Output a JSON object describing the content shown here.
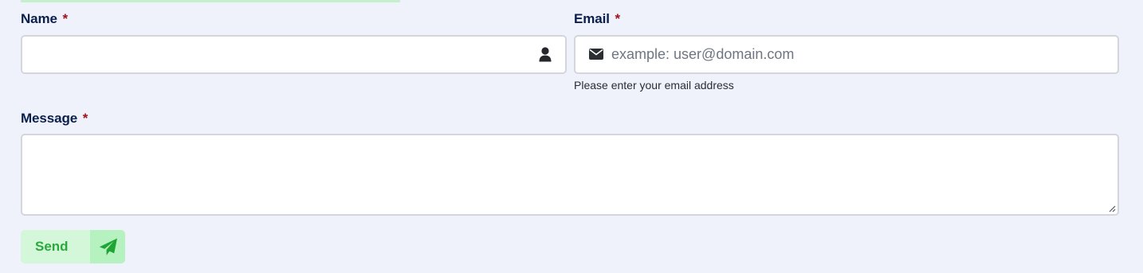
{
  "form": {
    "name": {
      "label": "Name",
      "required_mark": "*",
      "value": "",
      "icon": "user-icon"
    },
    "email": {
      "label": "Email",
      "required_mark": "*",
      "value": "",
      "placeholder": "example: user@domain.com",
      "icon": "envelope-icon",
      "helper": "Please enter your email address"
    },
    "message": {
      "label": "Message",
      "required_mark": "*",
      "value": ""
    },
    "send_button": {
      "label": "Send",
      "icon": "paper-plane-icon"
    }
  },
  "colors": {
    "background": "#eff2fb",
    "label": "#0a1f4c",
    "required": "#a0121c",
    "send_text": "#2aa93c",
    "send_bg": "#d4f7d9",
    "send_icon_bg": "#b6f1c0"
  }
}
